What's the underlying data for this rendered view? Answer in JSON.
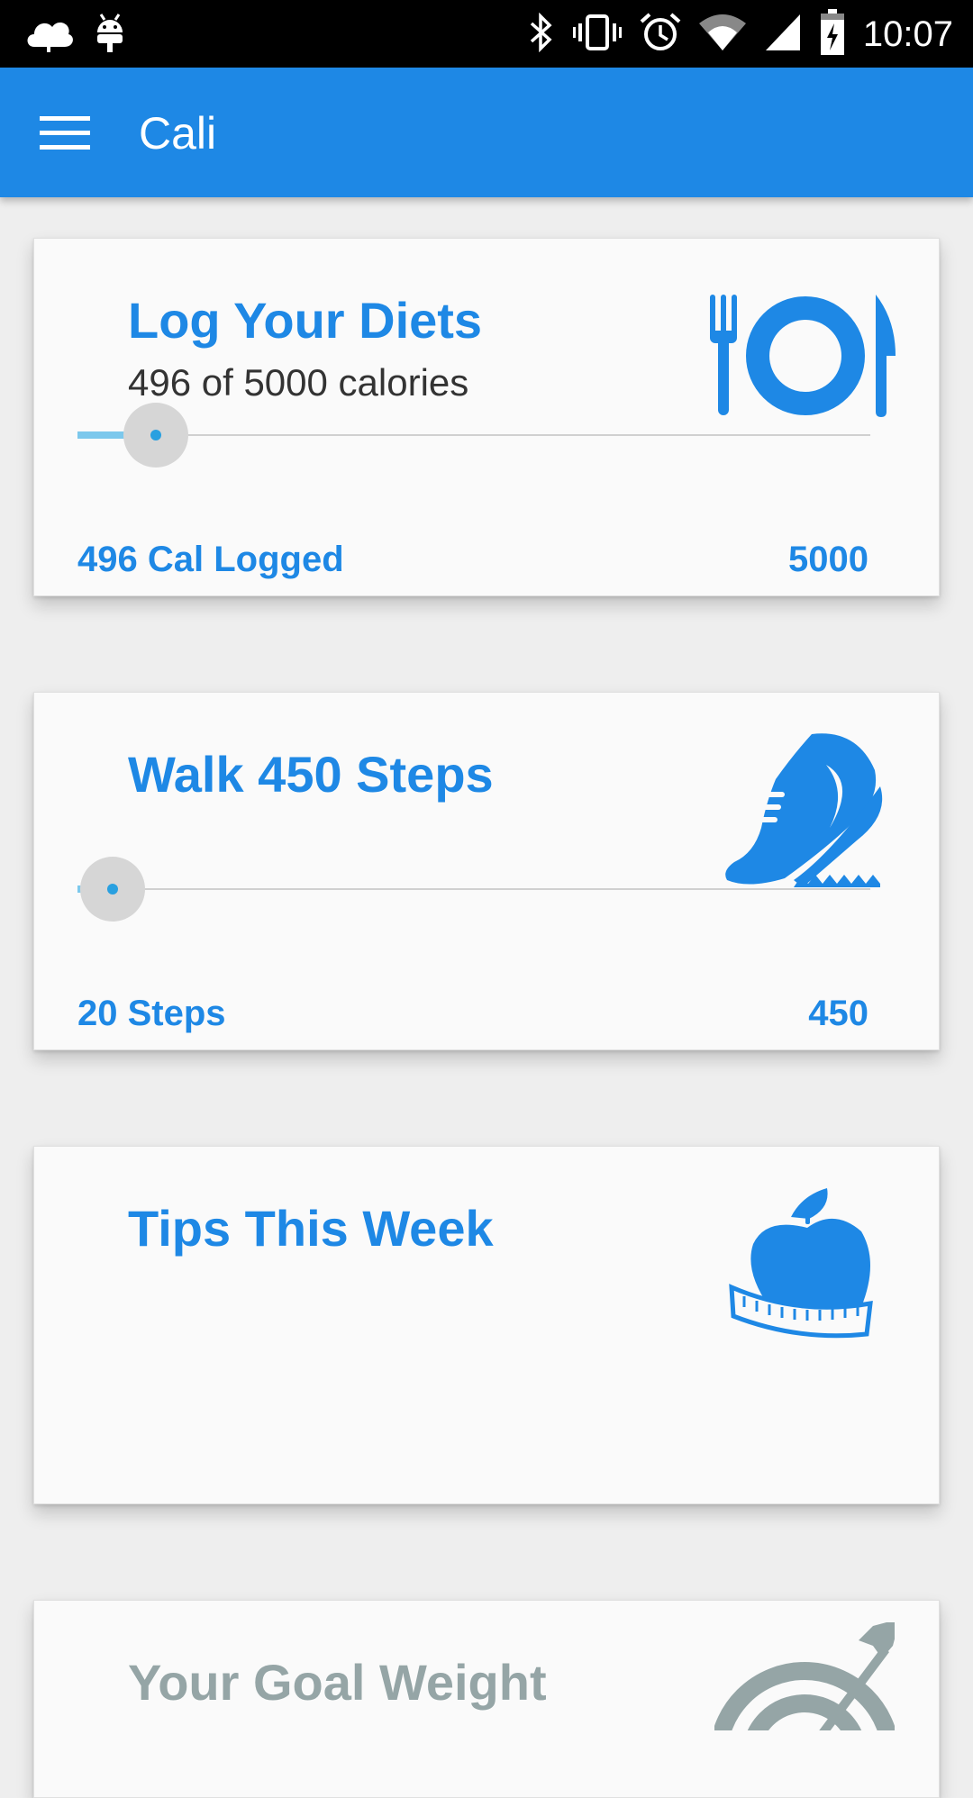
{
  "status_bar": {
    "time": "10:07",
    "icons": [
      "cloud-icon",
      "android-icon",
      "bluetooth-icon",
      "vibrate-icon",
      "alarm-icon",
      "wifi-icon",
      "signal-icon",
      "battery-charging-icon"
    ]
  },
  "app_bar": {
    "title": "Cali",
    "menu_icon": "hamburger-menu-icon"
  },
  "colors": {
    "primary": "#1e88e5",
    "goal_gray": "#95a5a6"
  },
  "cards": {
    "diets": {
      "title": "Log Your Diets",
      "subtitle": "496 of 5000 calories",
      "icon": "plate-cutlery-icon",
      "slider_value": 496,
      "slider_max": 5000,
      "left_label": "496 Cal Logged",
      "right_label": "5000"
    },
    "steps": {
      "title": "Walk 450 Steps",
      "icon": "running-shoe-icon",
      "slider_value": 20,
      "slider_max": 450,
      "left_label": "20 Steps",
      "right_label": "450"
    },
    "tips": {
      "title": "Tips This Week",
      "icon": "apple-measuring-tape-icon"
    },
    "goal": {
      "title": "Your Goal Weight",
      "icon": "target-arrow-icon"
    }
  }
}
